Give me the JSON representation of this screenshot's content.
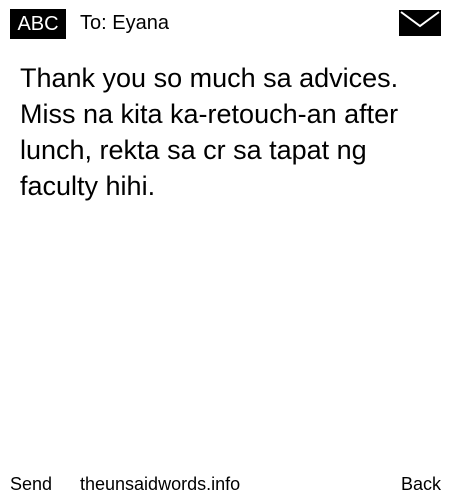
{
  "header": {
    "input_mode": "ABC",
    "recipient": "To: Eyana",
    "icon": "envelope-icon"
  },
  "message": {
    "body": "Thank you so much sa advices.\nMiss na kita ka-retouch-an after\nlunch, rekta sa cr sa tapat ng\nfaculty hihi."
  },
  "footer": {
    "left_softkey": "Send",
    "center_text": "theunsaidwords.info",
    "right_softkey": "Back"
  }
}
